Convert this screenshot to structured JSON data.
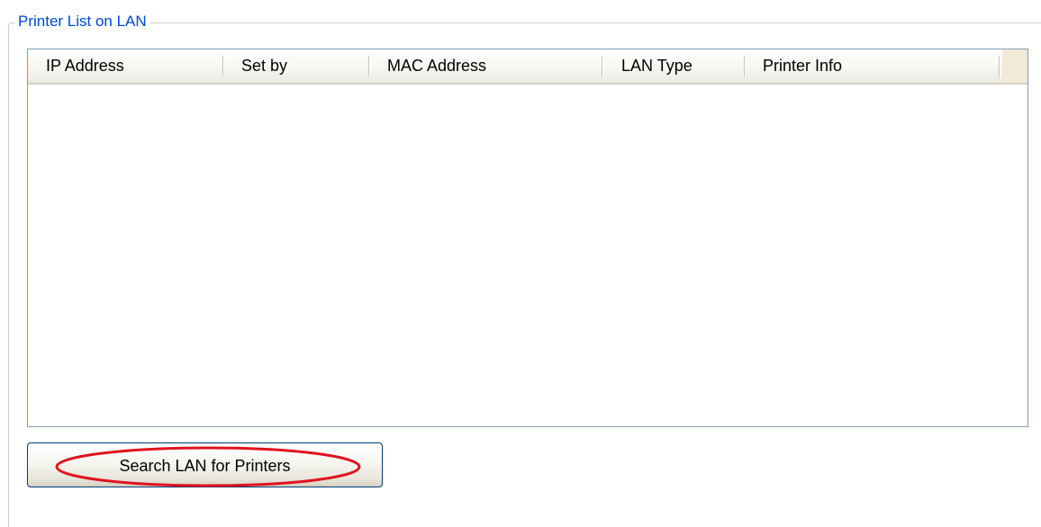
{
  "group": {
    "title": "Printer List on LAN"
  },
  "printer_list": {
    "columns": [
      {
        "label": "IP Address"
      },
      {
        "label": "Set by"
      },
      {
        "label": "MAC Address"
      },
      {
        "label": "LAN Type"
      },
      {
        "label": "Printer Info"
      }
    ],
    "rows": []
  },
  "actions": {
    "search_label": "Search LAN for Printers"
  },
  "colors": {
    "group_title": "#0046d5",
    "list_border": "#7f9db9",
    "button_border": "#003c74",
    "highlight_ellipse": "#e0141e"
  }
}
